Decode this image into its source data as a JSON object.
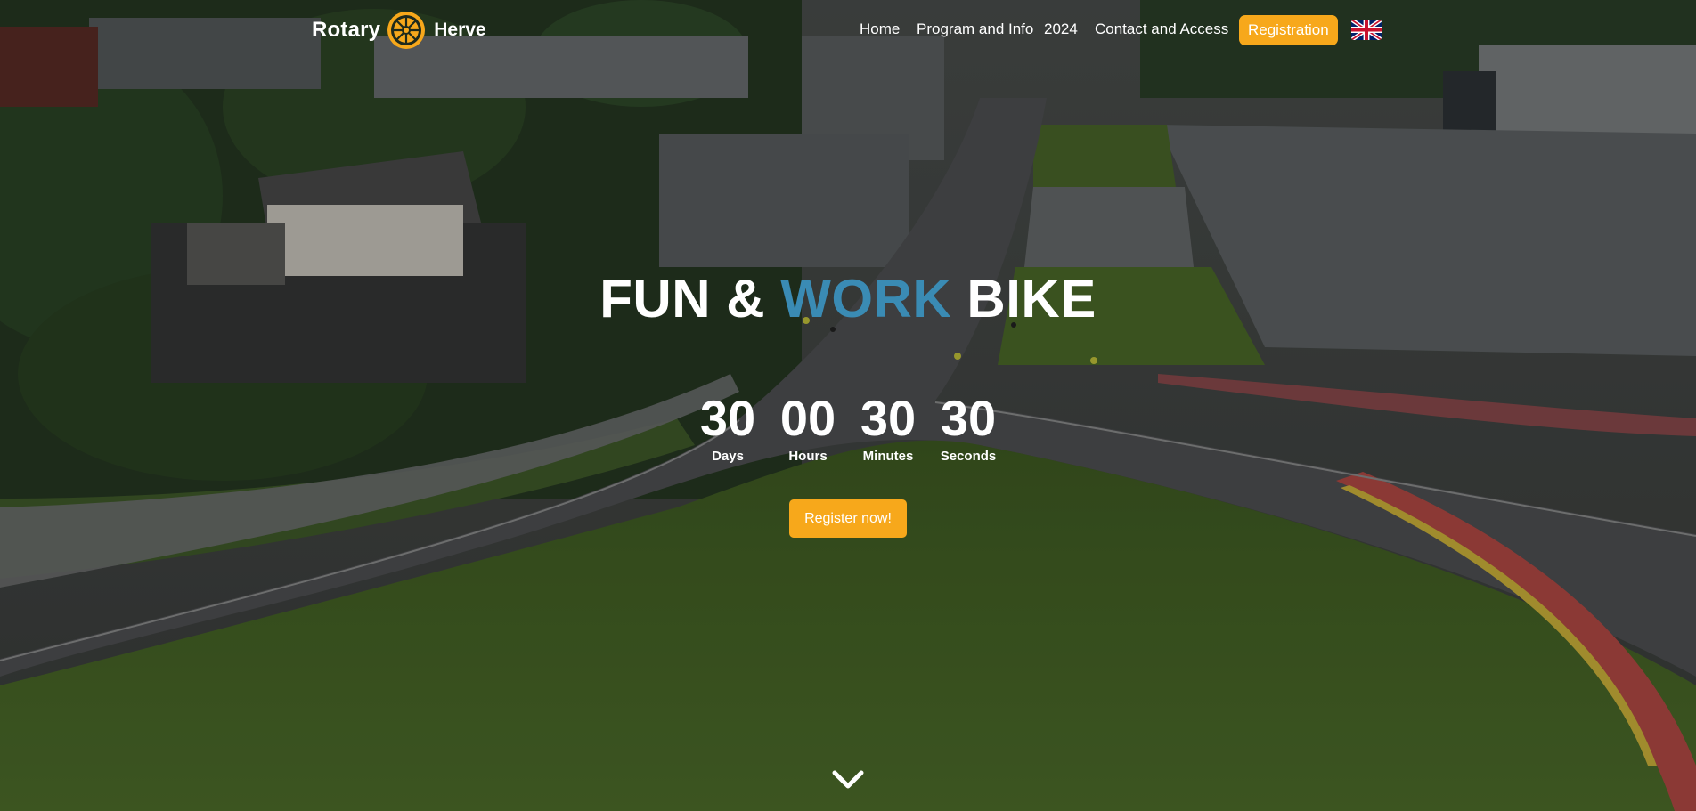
{
  "brand": {
    "left_word": "Rotary",
    "right_word": "Herve",
    "logo_icon": "rotary-wheel-icon"
  },
  "nav": {
    "items": [
      {
        "label": "Home"
      },
      {
        "label": "Program and Info"
      },
      {
        "label": "2024"
      },
      {
        "label": "Contact and Access"
      }
    ],
    "cta_label": "Registration",
    "language_icon": "uk-flag-icon"
  },
  "hero": {
    "title_part1": "FUN & ",
    "title_accent": "WORK",
    "title_part2": " BIKE",
    "countdown": [
      {
        "value": "30",
        "label": "Days"
      },
      {
        "value": "00",
        "label": "Hours"
      },
      {
        "value": "30",
        "label": "Minutes"
      },
      {
        "value": "30",
        "label": "Seconds"
      }
    ],
    "register_label": "Register now!",
    "scroll_icon": "chevron-down-icon"
  },
  "colors": {
    "accent_orange": "#f7a81b",
    "title_accent_blue": "#3a8bb4",
    "rotary_gold": "#f7a81b"
  }
}
